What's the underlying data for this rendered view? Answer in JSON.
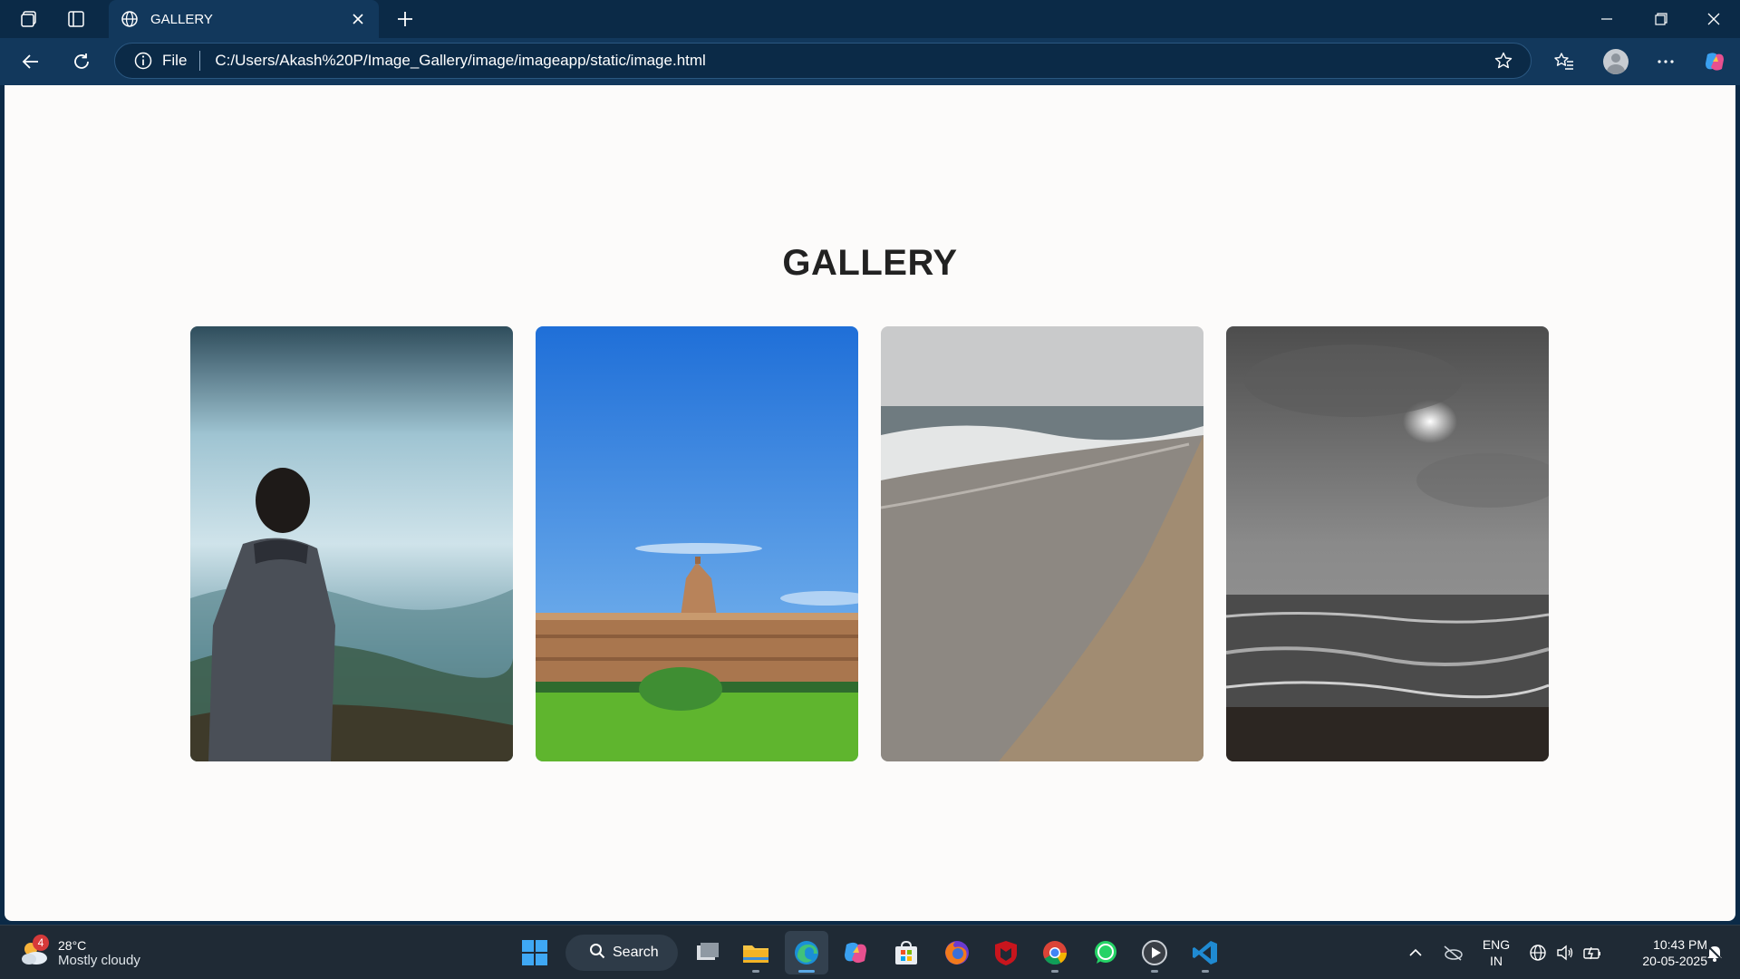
{
  "browser": {
    "tab_title": "GALLERY",
    "address_scheme": "File",
    "address_url": "C:/Users/Akash%20P/Image_Gallery/image/imageapp/static/image.html"
  },
  "page": {
    "title": "GALLERY",
    "images": [
      {
        "subject": "person in hoodie overlooking misty hills"
      },
      {
        "subject": "temple tower behind wall with green lawn"
      },
      {
        "subject": "sandy beach with waves"
      },
      {
        "subject": "cloudy sky over dark sea"
      }
    ]
  },
  "taskbar": {
    "weather_badge": "4",
    "weather_temp": "28°C",
    "weather_desc": "Mostly cloudy",
    "search_label": "Search",
    "lang_primary": "ENG",
    "lang_secondary": "IN",
    "time": "10:43 PM",
    "date": "20-05-2025"
  },
  "colors": {
    "titlebar": "#0b2a47",
    "toolbar": "#12385c",
    "page_bg": "#fcfbfa",
    "taskbar": "#1f2a35"
  }
}
